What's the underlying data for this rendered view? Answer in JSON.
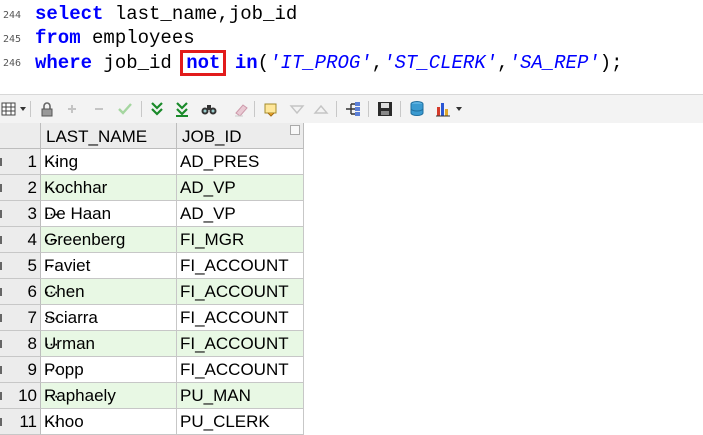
{
  "editor": {
    "lines": [
      {
        "number": "244",
        "keyword": "select",
        "rest": " last_name,job_id"
      },
      {
        "number": "245",
        "keyword": "from",
        "rest": " employees"
      },
      {
        "number": "246",
        "keyword": "where",
        "pre": " job_id ",
        "highlight": "not",
        "kw_in": " in",
        "open": "(",
        "s1": "'IT_PROG'",
        "c1": ",",
        "s2": "'ST_CLERK'",
        "c2": ",",
        "s3": "'SA_REP'",
        "close": ");"
      }
    ]
  },
  "colors": {
    "keyword": "#0000ff",
    "highlight_box": "#e21b1b",
    "alt_row": "#e8f8e4",
    "header_bg": "#ececec"
  },
  "toolbar": {
    "icons": [
      "grid-icon",
      "lock-icon",
      "add-icon",
      "remove-icon",
      "apply-icon",
      "filter-down-icon",
      "filter-clear-icon",
      "find-icon",
      "eraser-icon",
      "export-icon",
      "arrow-down-icon",
      "arrow-up-icon",
      "tree-icon",
      "save-icon",
      "database-icon",
      "chart-icon"
    ]
  },
  "grid": {
    "columns": [
      "LAST_NAME",
      "JOB_ID"
    ],
    "rows": [
      {
        "n": "1",
        "last_name": "King",
        "job_id": "AD_PRES"
      },
      {
        "n": "2",
        "last_name": "Kochhar",
        "job_id": "AD_VP"
      },
      {
        "n": "3",
        "last_name": "De Haan",
        "job_id": "AD_VP"
      },
      {
        "n": "4",
        "last_name": "Greenberg",
        "job_id": "FI_MGR"
      },
      {
        "n": "5",
        "last_name": "Faviet",
        "job_id": "FI_ACCOUNT"
      },
      {
        "n": "6",
        "last_name": "Chen",
        "job_id": "FI_ACCOUNT"
      },
      {
        "n": "7",
        "last_name": "Sciarra",
        "job_id": "FI_ACCOUNT"
      },
      {
        "n": "8",
        "last_name": "Urman",
        "job_id": "FI_ACCOUNT"
      },
      {
        "n": "9",
        "last_name": "Popp",
        "job_id": "FI_ACCOUNT"
      },
      {
        "n": "10",
        "last_name": "Raphaely",
        "job_id": "PU_MAN"
      },
      {
        "n": "11",
        "last_name": "Khoo",
        "job_id": "PU_CLERK"
      }
    ]
  }
}
